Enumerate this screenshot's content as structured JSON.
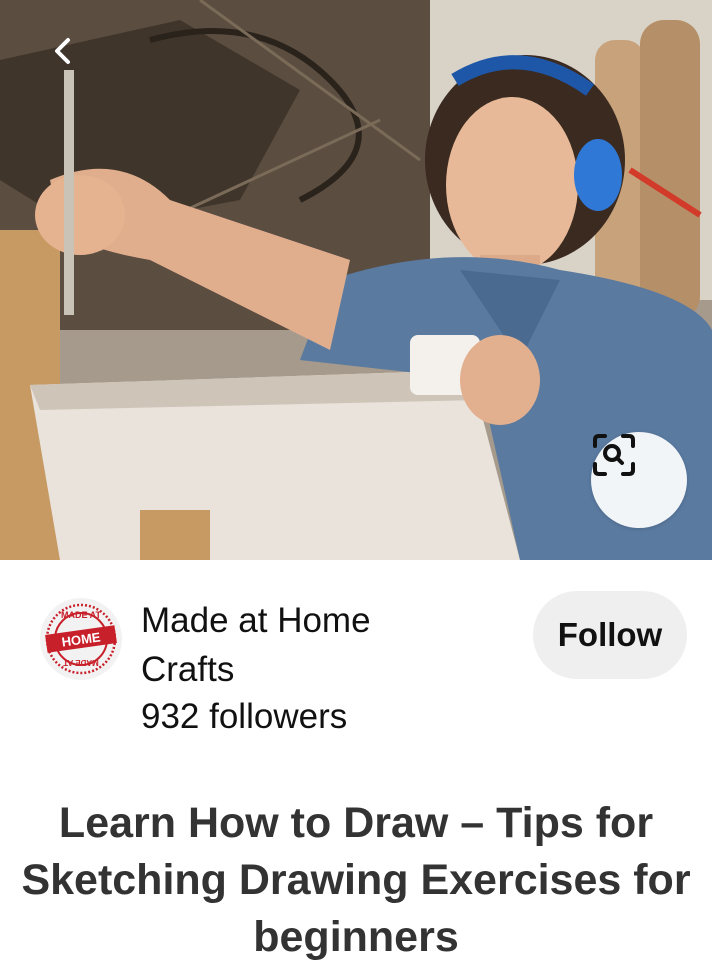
{
  "hero": {
    "icons": {
      "back": "chevron-left-icon",
      "visual_search": "visual-search-icon"
    }
  },
  "creator": {
    "name": "Made at Home Crafts",
    "followers": "932 followers",
    "follow_label": "Follow",
    "avatar_logo": {
      "top_text": "MADE AT",
      "center_text": "HOME",
      "bottom_text": "MADE AT",
      "color": "#c8202a"
    }
  },
  "pin": {
    "title": "Learn How to Draw – Tips for Sketching Drawing Exercises for beginners"
  },
  "colors": {
    "follow_bg": "#efefef",
    "title_text": "#333333",
    "logo_red": "#c8202a"
  }
}
